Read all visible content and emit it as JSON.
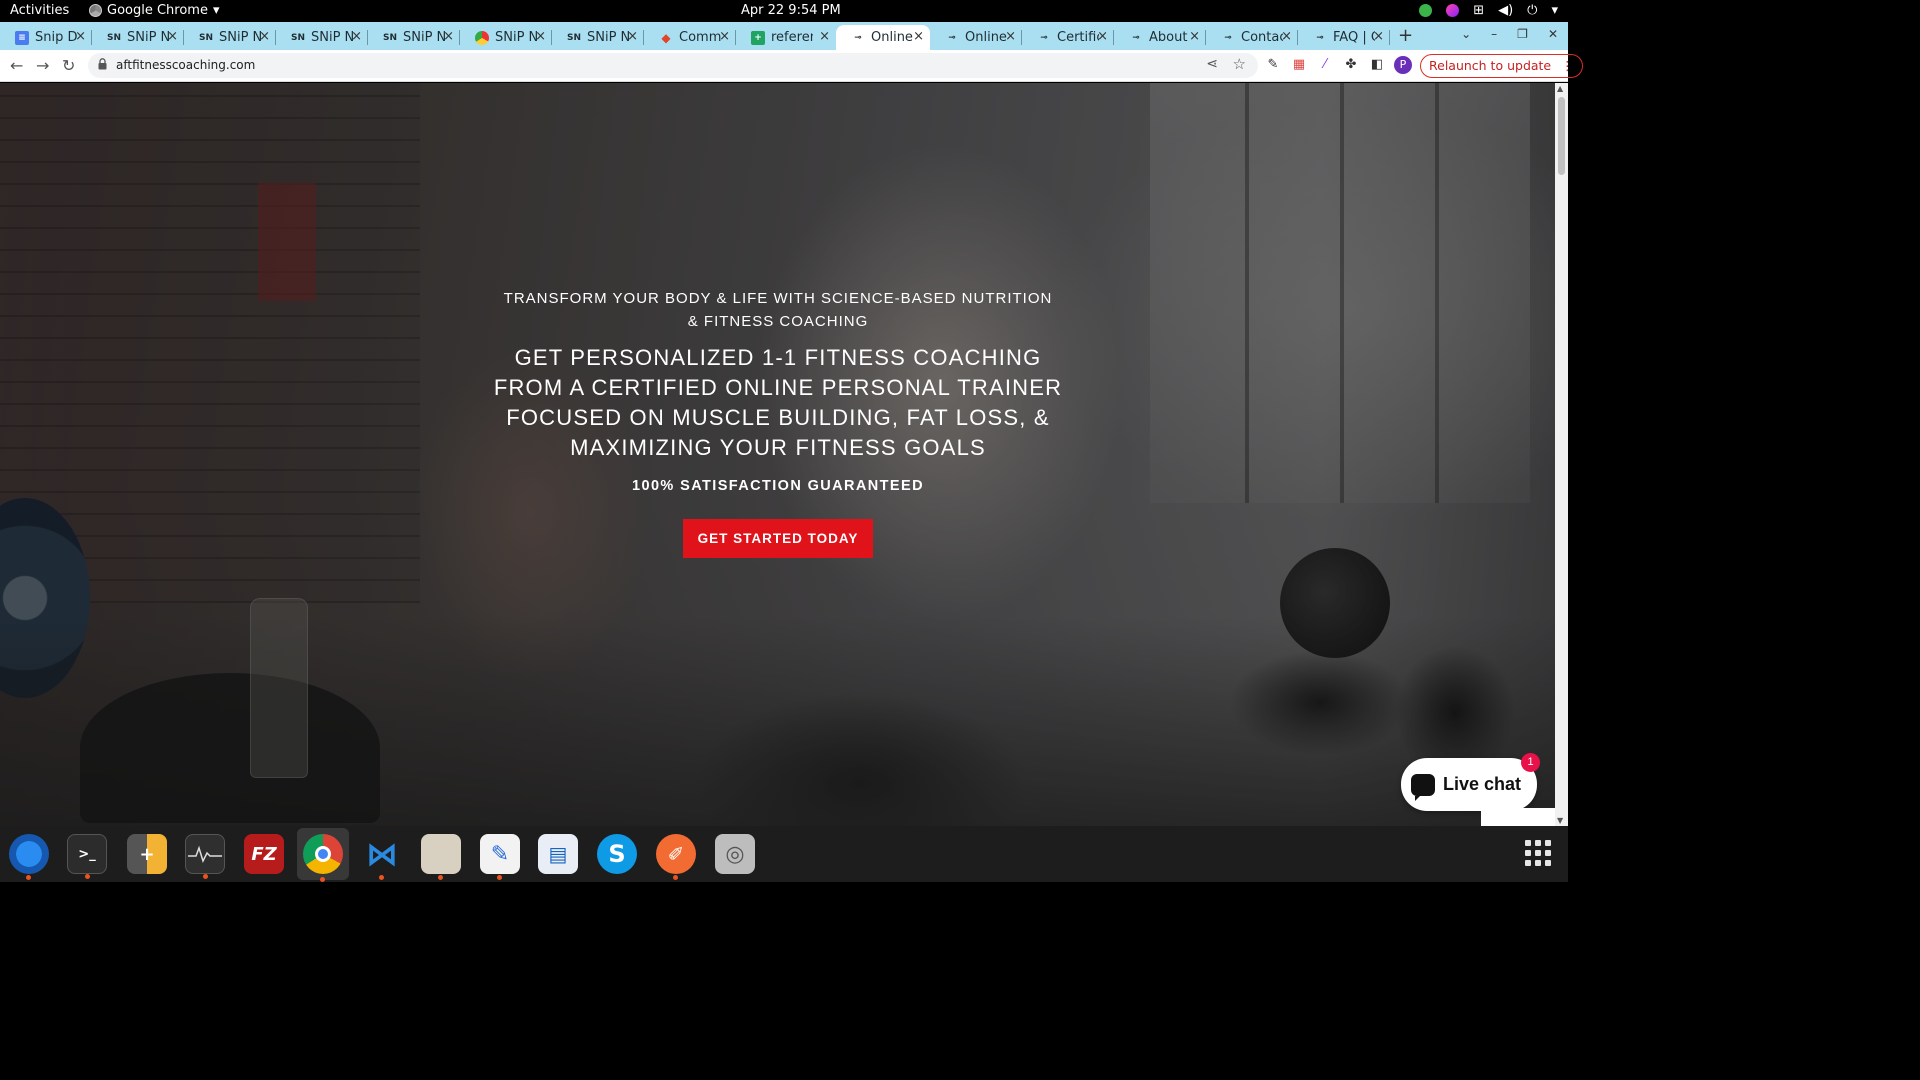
{
  "topbar": {
    "activities": "Activities",
    "app_name": "Google Chrome",
    "clock": "Apr 22  9:54 PM"
  },
  "tabs": [
    {
      "title": "Snip Dc",
      "icon": "docs-icon"
    },
    {
      "title": "SNiP N",
      "icon": "snip-icon"
    },
    {
      "title": "SNiP N",
      "icon": "snip-icon"
    },
    {
      "title": "SNiP N",
      "icon": "snip-icon"
    },
    {
      "title": "SNiP N",
      "icon": "snip-icon"
    },
    {
      "title": "SNiP N",
      "icon": "chrome-icon"
    },
    {
      "title": "SNiP N",
      "icon": "snip-icon"
    },
    {
      "title": "Commi",
      "icon": "gitlab-icon"
    },
    {
      "title": "referen",
      "icon": "sheets-icon"
    },
    {
      "title": "Online",
      "icon": "site-icon",
      "active": true
    },
    {
      "title": "Online",
      "icon": "site-icon"
    },
    {
      "title": "Certific",
      "icon": "site-icon"
    },
    {
      "title": "About",
      "icon": "site-icon"
    },
    {
      "title": "Contac",
      "icon": "site-icon"
    },
    {
      "title": "FAQ | C",
      "icon": "site-icon"
    }
  ],
  "toolbar": {
    "url": "aftfitnesscoaching.com",
    "avatar_letter": "P",
    "relaunch_label": "Relaunch to update"
  },
  "hero": {
    "subtitle": "TRANSFORM YOUR BODY & LIFE WITH SCIENCE-BASED NUTRITION & FITNESS COACHING",
    "title": "GET PERSONALIZED 1-1 FITNESS COACHING FROM A CERTIFIED ONLINE PERSONAL TRAINER FOCUSED ON MUSCLE BUILDING, FAT LOSS, & MAXIMIZING YOUR FITNESS GOALS",
    "guarantee": "100% SATISFACTION GUARANTEED",
    "cta_label": "GET STARTED TODAY"
  },
  "live_chat": {
    "label": "Live chat",
    "badge": "1"
  },
  "colors": {
    "cta_red": "#e0131b",
    "tabstrip": "#a9dff1",
    "relaunch_red": "#c5221f",
    "chat_badge": "#e8114a"
  },
  "dock": [
    {
      "name": "thunderbird-icon",
      "glyph": ""
    },
    {
      "name": "terminal-icon",
      "glyph": ">_"
    },
    {
      "name": "calculator-icon",
      "glyph": "+"
    },
    {
      "name": "system-monitor-icon",
      "glyph": ""
    },
    {
      "name": "filezilla-icon",
      "glyph": "FZ"
    },
    {
      "name": "chrome-icon",
      "glyph": ""
    },
    {
      "name": "vscode-icon",
      "glyph": ""
    },
    {
      "name": "files-icon",
      "glyph": ""
    },
    {
      "name": "text-editor-icon",
      "glyph": ""
    },
    {
      "name": "libreoffice-writer-icon",
      "glyph": ""
    },
    {
      "name": "skype-icon",
      "glyph": "S"
    },
    {
      "name": "postman-icon",
      "glyph": ""
    },
    {
      "name": "disk-icon",
      "glyph": ""
    }
  ]
}
